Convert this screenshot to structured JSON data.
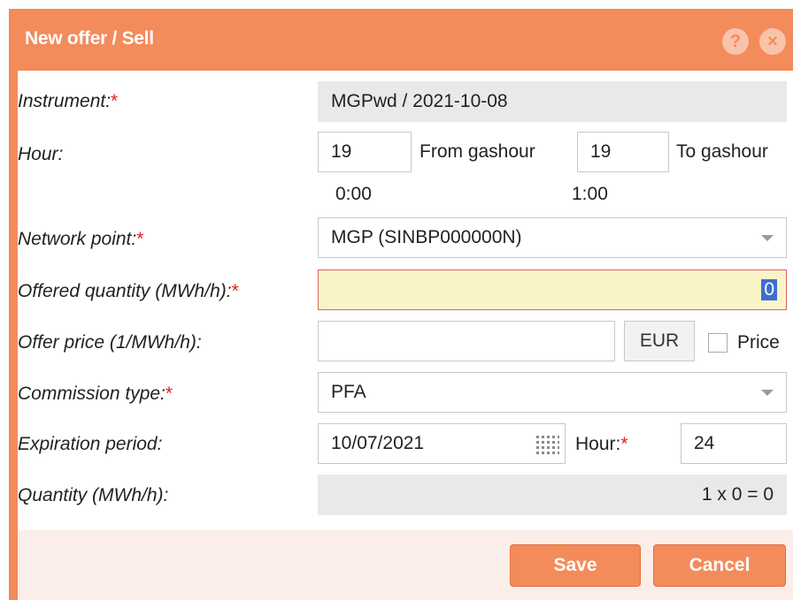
{
  "dialog": {
    "title": "New offer / Sell",
    "help_icon": "?",
    "close_icon": "×"
  },
  "form": {
    "instrument": {
      "label": "Instrument:",
      "required": "*",
      "value": "MGPwd / 2021-10-08"
    },
    "hour": {
      "label": "Hour:",
      "from_value": "19",
      "from_label": "From gashour",
      "from_time": "0:00",
      "to_value": "19",
      "to_label": "To gashour",
      "to_time": "1:00"
    },
    "network_point": {
      "label": "Network point:",
      "required": "*",
      "value": "MGP (SINBP000000N)"
    },
    "offered_quantity": {
      "label": "Offered quantity (MWh/h):",
      "required": "*",
      "value": "0"
    },
    "offer_price": {
      "label": "Offer price (1/MWh/h):",
      "value": "",
      "currency": "EUR",
      "checkbox_label": "Price",
      "checked": false
    },
    "commission_type": {
      "label": "Commission type:",
      "required": "*",
      "value": "PFA"
    },
    "expiration_period": {
      "label": "Expiration period:",
      "value": "10/07/2021",
      "hour_label": "Hour:",
      "hour_required": "*",
      "hour_value": "24"
    },
    "quantity": {
      "label": "Quantity (MWh/h):",
      "value": "1 x 0 = 0"
    }
  },
  "buttons": {
    "save": "Save",
    "cancel": "Cancel"
  },
  "colors": {
    "accent": "#f48b5b",
    "required": "#e0201b",
    "highlight": "#fbf3c8"
  }
}
